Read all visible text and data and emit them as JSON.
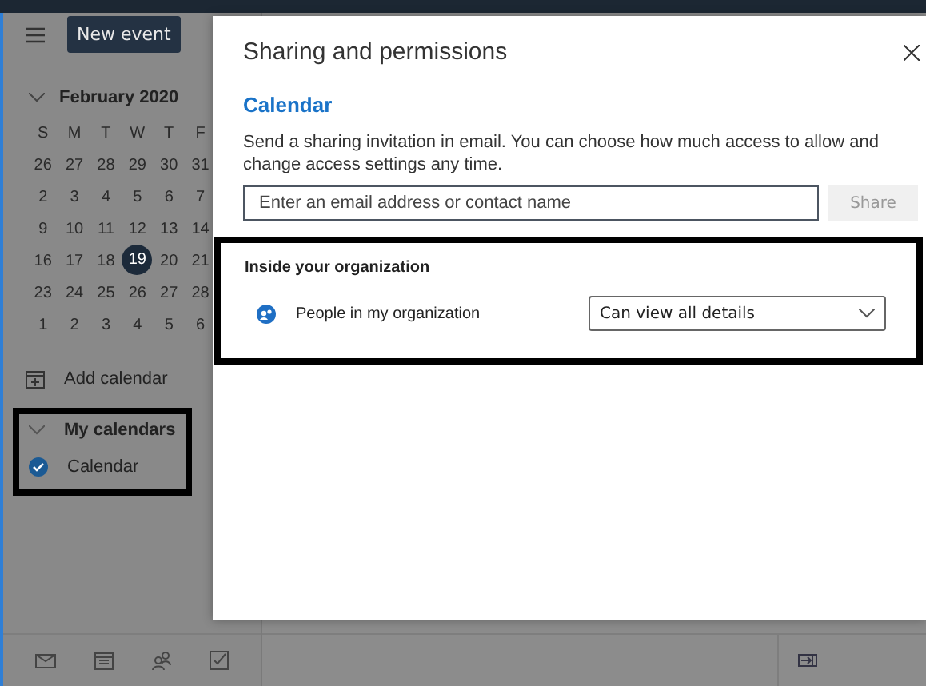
{
  "top_bar": {
    "new_event_button": "New event"
  },
  "mini_calendar": {
    "month": "February 2020",
    "weekdays": [
      "S",
      "M",
      "T",
      "W",
      "T",
      "F"
    ],
    "weeks": [
      [
        {
          "day": "26",
          "selected": false
        },
        {
          "day": "27",
          "selected": false
        },
        {
          "day": "28",
          "selected": false
        },
        {
          "day": "29",
          "selected": false
        },
        {
          "day": "30",
          "selected": false
        },
        {
          "day": "31",
          "selected": false
        }
      ],
      [
        {
          "day": "2",
          "selected": false
        },
        {
          "day": "3",
          "selected": false
        },
        {
          "day": "4",
          "selected": false
        },
        {
          "day": "5",
          "selected": false
        },
        {
          "day": "6",
          "selected": false
        },
        {
          "day": "7",
          "selected": false
        }
      ],
      [
        {
          "day": "9",
          "selected": false
        },
        {
          "day": "10",
          "selected": false
        },
        {
          "day": "11",
          "selected": false
        },
        {
          "day": "12",
          "selected": false
        },
        {
          "day": "13",
          "selected": false
        },
        {
          "day": "14",
          "selected": false
        }
      ],
      [
        {
          "day": "16",
          "selected": false
        },
        {
          "day": "17",
          "selected": false
        },
        {
          "day": "18",
          "selected": false
        },
        {
          "day": "19",
          "selected": true
        },
        {
          "day": "20",
          "selected": false
        },
        {
          "day": "21",
          "selected": false
        }
      ],
      [
        {
          "day": "23",
          "selected": false
        },
        {
          "day": "24",
          "selected": false
        },
        {
          "day": "25",
          "selected": false
        },
        {
          "day": "26",
          "selected": false
        },
        {
          "day": "27",
          "selected": false
        },
        {
          "day": "28",
          "selected": false
        }
      ],
      [
        {
          "day": "1",
          "selected": false
        },
        {
          "day": "2",
          "selected": false
        },
        {
          "day": "3",
          "selected": false
        },
        {
          "day": "4",
          "selected": false
        },
        {
          "day": "5",
          "selected": false
        },
        {
          "day": "6",
          "selected": false
        }
      ]
    ]
  },
  "sidebar": {
    "add_calendar": "Add calendar",
    "my_calendars": {
      "label": "My calendars",
      "expanded": true,
      "items": [
        {
          "name": "Calendar",
          "checked": true
        }
      ]
    }
  },
  "dialog": {
    "title": "Sharing and permissions",
    "calendar_name": "Calendar",
    "description": "Send a sharing invitation in email. You can choose how much access to allow and change access settings any time.",
    "email_field": {
      "placeholder": "Enter an email address or contact name"
    },
    "share_button": {
      "label": "Share",
      "disabled": true
    },
    "section": {
      "heading": "Inside your organization",
      "rows": [
        {
          "name": "People in my organization",
          "access": "Can view all details"
        }
      ]
    }
  }
}
